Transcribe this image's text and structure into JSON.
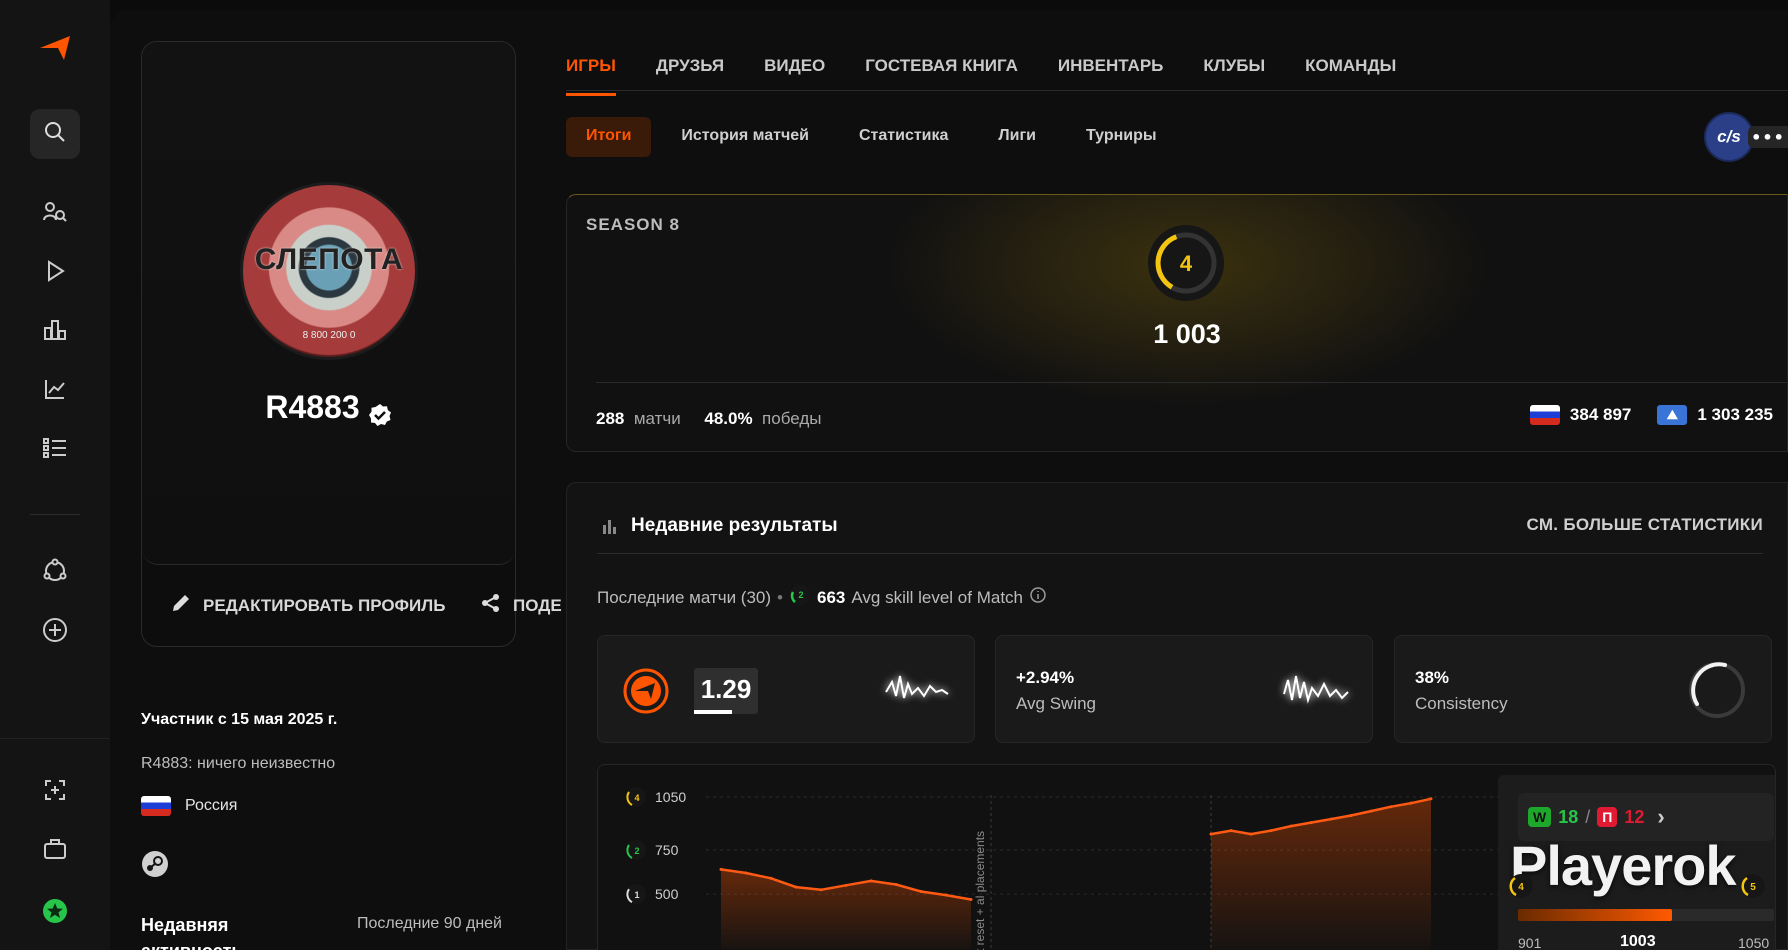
{
  "tabs": [
    "ИГРЫ",
    "ДРУЗЬЯ",
    "ВИДЕО",
    "ГОСТЕВАЯ КНИГА",
    "ИНВЕНТАРЬ",
    "КЛУБЫ",
    "КОМАНДЫ"
  ],
  "subtabs": [
    "Итоги",
    "История матчей",
    "Статистика",
    "Лиги",
    "Турниры"
  ],
  "game_badge": "c/s",
  "game_more": "•••",
  "profile": {
    "avatar_word": "СЛЕПОТА",
    "avatar_phone": "8 800 200 0",
    "nickname": "R4883",
    "edit_label": "РЕДАКТИРОВАТЬ ПРОФИЛЬ",
    "share_label": "ПОДЕ",
    "member_since": "Участник с 15 мая 2025 г.",
    "bio": "R4883: ничего неизвестно",
    "country": "Россия",
    "recent_activity_label": "Недавняя активность",
    "recent_activity_value": "Последние 90 дней"
  },
  "season": {
    "label": "SEASON 8",
    "level": "4",
    "elo": "1 003",
    "matches_value": "288",
    "matches_label": "матчи",
    "wins_value": "48.0%",
    "wins_label": "победы",
    "country_rank": "384 897",
    "region_rank": "1 303 235"
  },
  "recent": {
    "title": "Недавние результаты",
    "more_label": "СМ. БОЛЬШЕ СТАТИСТИКИ",
    "last_matches": "Последние матчи (30)",
    "bullet": "•",
    "avg_level_badge": "2",
    "avg_skill_value": "663",
    "avg_skill_label": "Avg skill level of Match",
    "rating_value": "1.29",
    "swing_value": "+2.94%",
    "swing_label": "Avg Swing",
    "consistency_value": "38%",
    "consistency_label": "Consistency"
  },
  "chart_data": {
    "type": "area",
    "y_ticks": [
      {
        "value": 1050,
        "label": "1050",
        "level": "4"
      },
      {
        "value": 750,
        "label": "750",
        "level": "2"
      },
      {
        "value": 500,
        "label": "500",
        "level": "1"
      }
    ],
    "annotation": "t reset + al placements",
    "series": [
      {
        "values": [
          640,
          620,
          590,
          540,
          525,
          550,
          575,
          555,
          515,
          495,
          470
        ]
      },
      {
        "values": [
          840,
          860,
          840,
          860,
          885,
          905,
          925,
          945,
          970,
          995,
          1015,
          1040
        ]
      }
    ]
  },
  "wl": {
    "w_label": "W",
    "wins": "18",
    "slash": "/",
    "l_label": "П",
    "losses": "12",
    "chevron": "›",
    "brand": "Playerok",
    "level_left": "4",
    "level_right": "5",
    "progress_fraction": 0.6,
    "min": "901",
    "current": "1003",
    "max": "1050"
  },
  "colors": {
    "accent": "#ff5500",
    "level_yellow": "#f3c511",
    "win": "#1ea82b",
    "loss": "#e01a32"
  }
}
